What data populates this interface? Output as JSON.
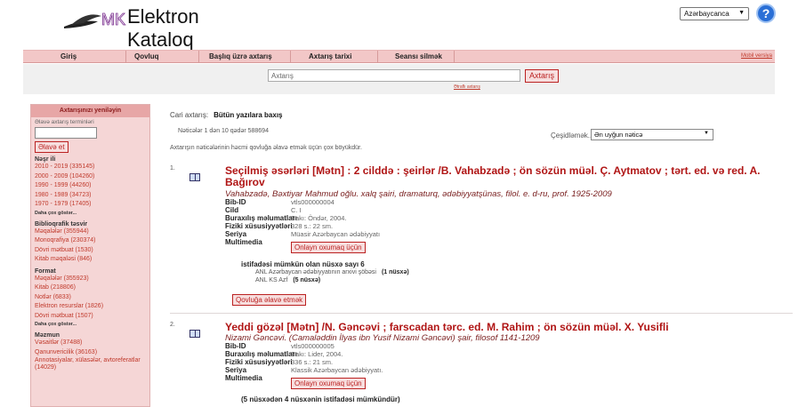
{
  "header": {
    "logo_text": "MK",
    "title": "Elektron Kataloq",
    "language": "Azərbaycanca",
    "help_icon": "help-icon"
  },
  "nav": {
    "items": [
      "Giriş",
      "Qovluq",
      "Başlıq üzrə axtarış",
      "Axtarış tarixi",
      "Seansı silmək"
    ],
    "mobile": "Mobil versiya"
  },
  "search": {
    "placeholder": "Axtarış",
    "button": "Axtarış",
    "advanced": "Ətraflı axtarış"
  },
  "sidebar": {
    "title": "Axtarışınızı yeniləyin",
    "add_terms_label": "Əlavə axtarış terminləri",
    "add_button": "Əlavə et",
    "groups": [
      {
        "title": "Nəşr ili",
        "items": [
          "2010 - 2019 (335145)",
          "2000 - 2009 (104260)",
          "1990 - 1999 (44260)",
          "1980 - 1989 (34723)",
          "1970 - 1979 (17405)"
        ],
        "more": "Daha çox göstər..."
      },
      {
        "title": "Biblioqrafik təsvir",
        "items": [
          "Məqalələr (355944)",
          "Monoqrafiya (230374)",
          "Dövri mətbuat (1530)",
          "Kitab məqaləsi (846)"
        ],
        "more": ""
      },
      {
        "title": "Format",
        "items": [
          "Məqalələr (355923)",
          "Kitab (218806)",
          "Notlər (6833)",
          "Elektron resurslar (1826)",
          "Dövri mətbuat (1507)"
        ],
        "more": "Daha çox göstər..."
      },
      {
        "title": "Məzmun",
        "items": [
          "Vəsaitlər (37488)",
          "Qanunvericilik (36163)",
          "Annotasiyalar, xülasələr, avtoreferatlar",
          "(14029)"
        ],
        "more": ""
      }
    ]
  },
  "main": {
    "crumb_label": "Cari axtarış:",
    "crumb_value": "Bütün yazılara baxış",
    "count": "Nəticələr 1 dən 10 qədər 588694",
    "sort_label": "Çeşidləmək...",
    "sort_value": "Ən uyğun nəticə",
    "notice": "Axtarışın nəticələrinin həcmi qovluğa əlavə etmək üçün çox böyükdür."
  },
  "results": [
    {
      "num": "1.",
      "title": "Seçilmiş əsərləri [Mətn] : 2 cilddə : şeirlər /B. Vahabzadə ; ön sözün müəl. Ç. Aytmatov ; tərt. ed. və red. A. Bağırov",
      "author": "Vahabzadə, Bəxtiyar Mahmud oğlu. xalq şairi, dramaturq, ədəbiyyatşünas, filol. e. d-ru, prof. 1925-2009",
      "fields": [
        {
          "label": "Bib-ID",
          "value": "vtls000000004"
        },
        {
          "label": "Cild",
          "value": "C. I"
        },
        {
          "label": "Buraxılış məlumatları",
          "value": "Bakı: Öndər, 2004."
        },
        {
          "label": "Fiziki xüsusiyyətləri",
          "value": "328 s.: 22 sm."
        },
        {
          "label": "Seriya",
          "value": "Müasir Azərbaycan ədəbiyyatı"
        },
        {
          "label": "Multimedia",
          "value": ""
        }
      ],
      "online": "Onlayn oxumaq üçün",
      "availability": "istifadəsi mümkün olan nüsxə sayı 6",
      "copies": [
        {
          "loc": "ANL Azərbaycan ədəbiyyatının arxivi şöbəsi",
          "count": "(1 nüsxə)"
        },
        {
          "loc": "ANL KS Azf",
          "count": "(5 nüsxə)"
        }
      ],
      "add_to_folder": "Qovluğa əlavə etmək"
    },
    {
      "num": "2.",
      "title": "Yeddi gözəl [Mətn] /N. Gəncəvi ; farscadan tərc. ed. M. Rahim ; ön sözün müəl. X. Yusifli",
      "author": "Nizami Gəncəvi. (Camaləddin İlyas ibn Yusif Nizami Gəncəvi) şair, filosof 1141-1209",
      "fields": [
        {
          "label": "Bib-ID",
          "value": "vtls000000005"
        },
        {
          "label": "Buraxılış məlumatları",
          "value": "Bakı: Lider, 2004."
        },
        {
          "label": "Fiziki xüsusiyyətləri",
          "value": "336 s.: 21 sm."
        },
        {
          "label": "Seriya",
          "value": "Klassik Azərbaycan ədəbiyyatı."
        },
        {
          "label": "Multimedia",
          "value": ""
        }
      ],
      "online": "Onlayn oxumaq üçün",
      "availability": "(5 nüsxədən 4 nüsxənin istifadəsi mümkündür)"
    }
  ]
}
